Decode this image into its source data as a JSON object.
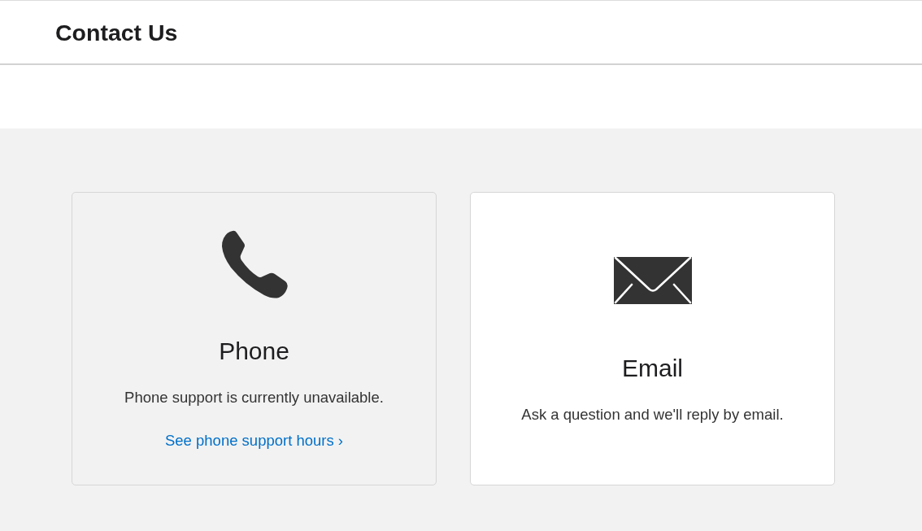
{
  "header": {
    "title": "Contact Us"
  },
  "options": [
    {
      "kind": "phone",
      "title": "Phone",
      "description": "Phone support is currently unavailable.",
      "link": "See phone support hours ›",
      "disabled": true
    },
    {
      "kind": "email",
      "title": "Email",
      "description": "Ask a question and we'll reply by email.",
      "disabled": false
    }
  ]
}
